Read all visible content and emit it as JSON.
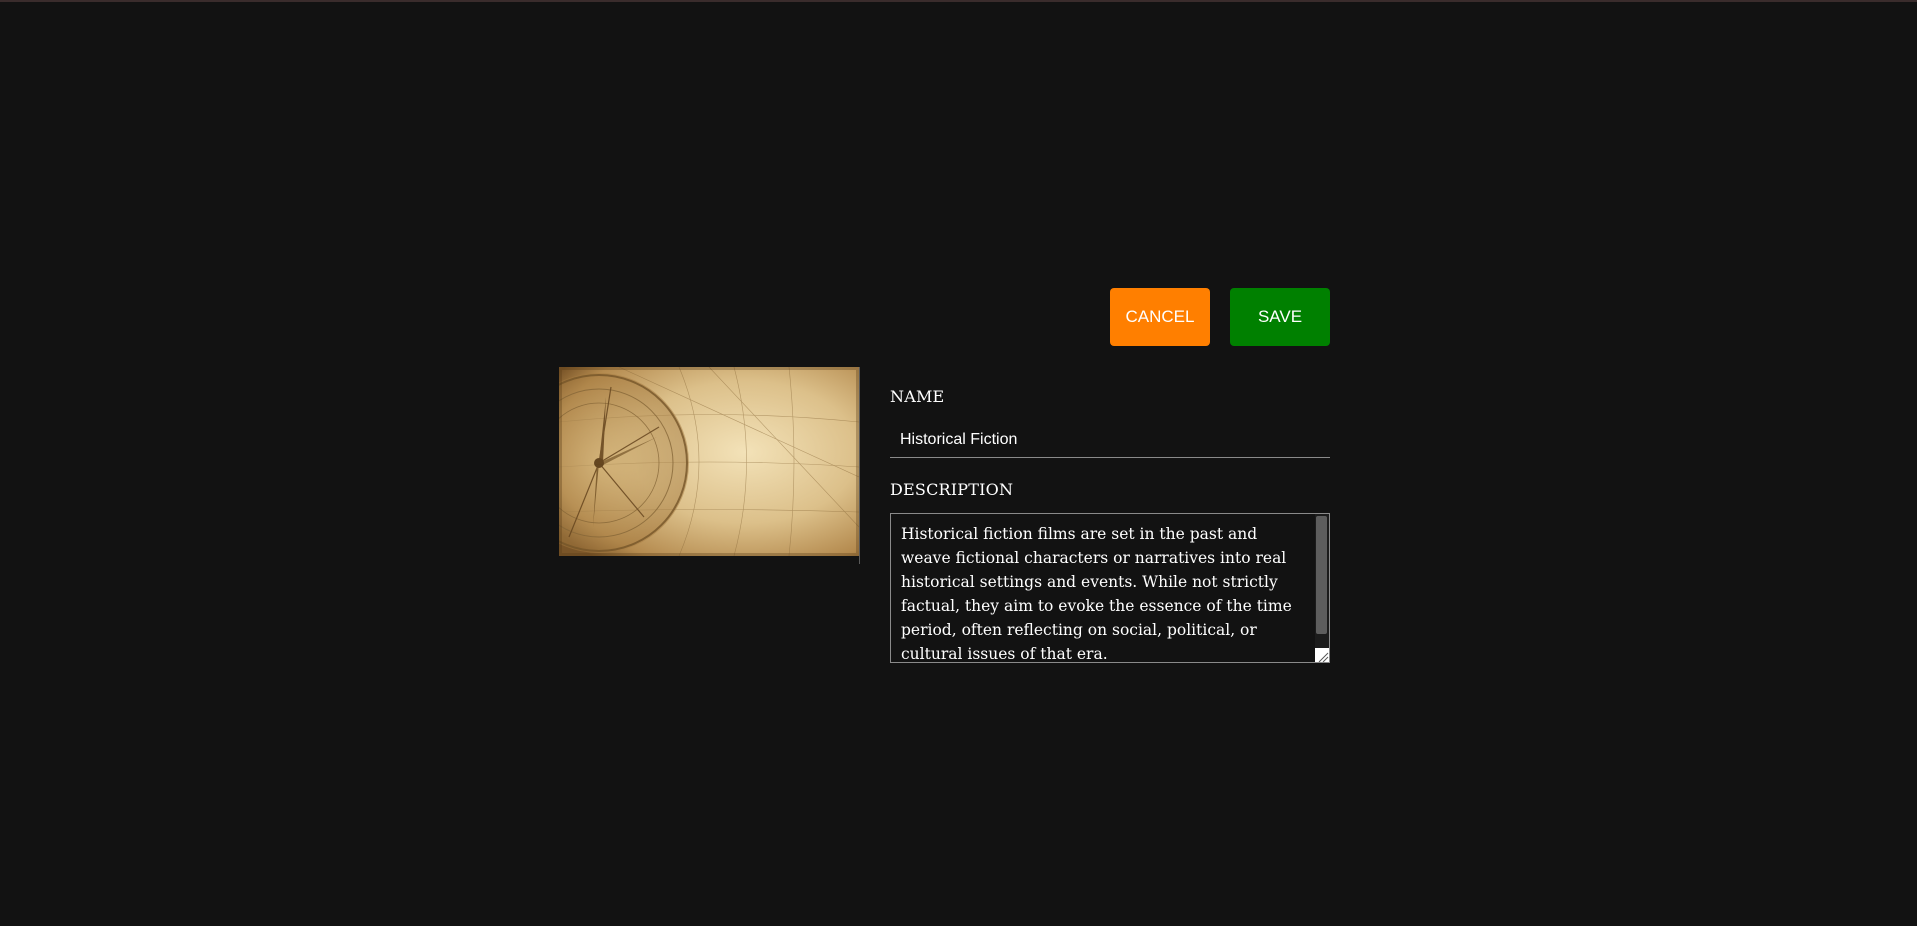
{
  "toolbar": {
    "cancel_label": "CANCEL",
    "save_label": "SAVE"
  },
  "form": {
    "name_label": "NAME",
    "name_value": "Historical Fiction",
    "description_label": "DESCRIPTION",
    "description_value": "Historical fiction films are set in the past and weave fictional characters or narratives into real historical settings and events. While not strictly factual, they aim to evoke the essence of the time period, often reflecting on social, political, or cultural issues of that era."
  },
  "colors": {
    "background": "#121212",
    "cancel": "#ff7f00",
    "save": "#008000"
  },
  "icons": {
    "resize": "resize-grip-icon"
  }
}
